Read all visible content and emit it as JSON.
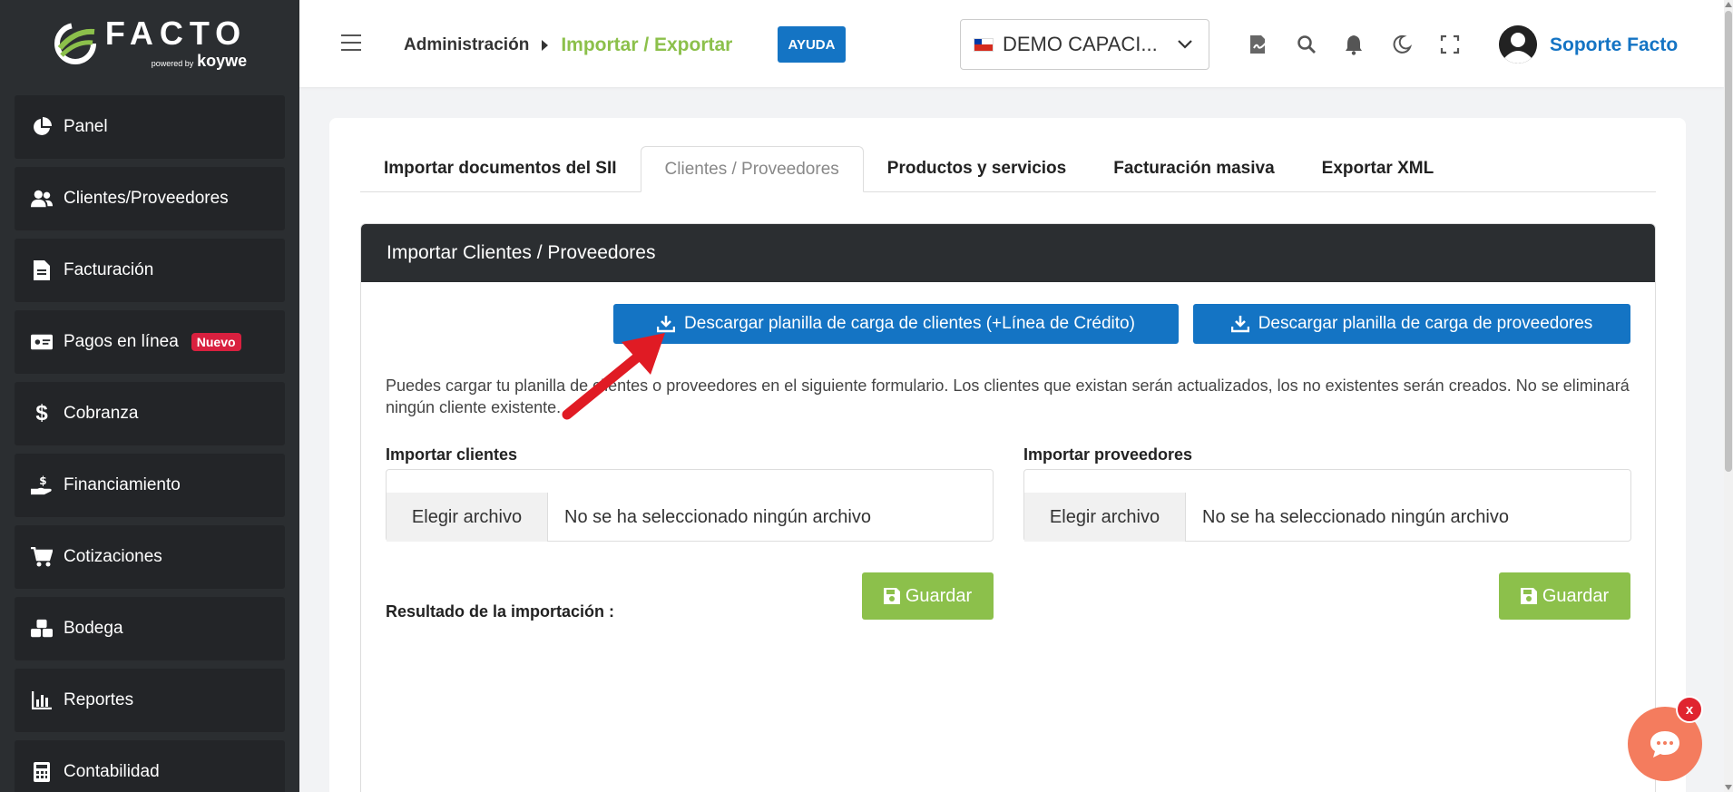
{
  "brand": {
    "name": "FACTO",
    "powered_by": "powered by",
    "partner": "koywe"
  },
  "sidebar": {
    "items": [
      {
        "label": "Panel",
        "icon": "pie-chart-icon"
      },
      {
        "label": "Clientes/Proveedores",
        "icon": "users-icon"
      },
      {
        "label": "Facturación",
        "icon": "document-icon"
      },
      {
        "label": "Pagos en línea",
        "icon": "money-bill-icon",
        "badge": "Nuevo"
      },
      {
        "label": "Cobranza",
        "icon": "dollar-icon"
      },
      {
        "label": "Financiamiento",
        "icon": "hand-money-icon"
      },
      {
        "label": "Cotizaciones",
        "icon": "cart-icon"
      },
      {
        "label": "Bodega",
        "icon": "boxes-icon"
      },
      {
        "label": "Reportes",
        "icon": "bar-chart-icon"
      },
      {
        "label": "Contabilidad",
        "icon": "calculator-icon"
      }
    ]
  },
  "header": {
    "breadcrumb": [
      "Administración",
      "Importar / Exportar"
    ],
    "help_label": "AYUDA",
    "company": "DEMO CAPACI...",
    "user": "Soporte Facto"
  },
  "tabs": [
    {
      "label": "Importar documentos del SII",
      "active": false
    },
    {
      "label": "Clientes / Proveedores",
      "active": true
    },
    {
      "label": "Productos y servicios",
      "active": false
    },
    {
      "label": "Facturación masiva",
      "active": false
    },
    {
      "label": "Exportar XML",
      "active": false
    }
  ],
  "panel": {
    "title": "Importar Clientes / Proveedores",
    "download_clients": "Descargar planilla de carga de clientes (+Línea de Crédito)",
    "download_suppliers": "Descargar planilla de carga de proveedores",
    "info": "Puedes cargar tu planilla de clientes o proveedores en el siguiente formulario. Los clientes que existan serán actualizados, los no existentes serán creados. No se eliminará ningún cliente existente.",
    "import_clients_label": "Importar clientes",
    "import_suppliers_label": "Importar proveedores",
    "choose_file": "Elegir archivo",
    "no_file": "No se ha seleccionado ningún archivo",
    "save_label": "Guardar",
    "result_label": "Resultado de la importación :"
  },
  "chat": {
    "close_label": "x"
  },
  "colors": {
    "sidebar_bg": "#2b2e31",
    "accent_green": "#8cc04b",
    "accent_blue": "#1474c4",
    "badge_red": "#d9203f",
    "chat": "#f47c5e",
    "annotation_arrow": "#e01b24"
  }
}
